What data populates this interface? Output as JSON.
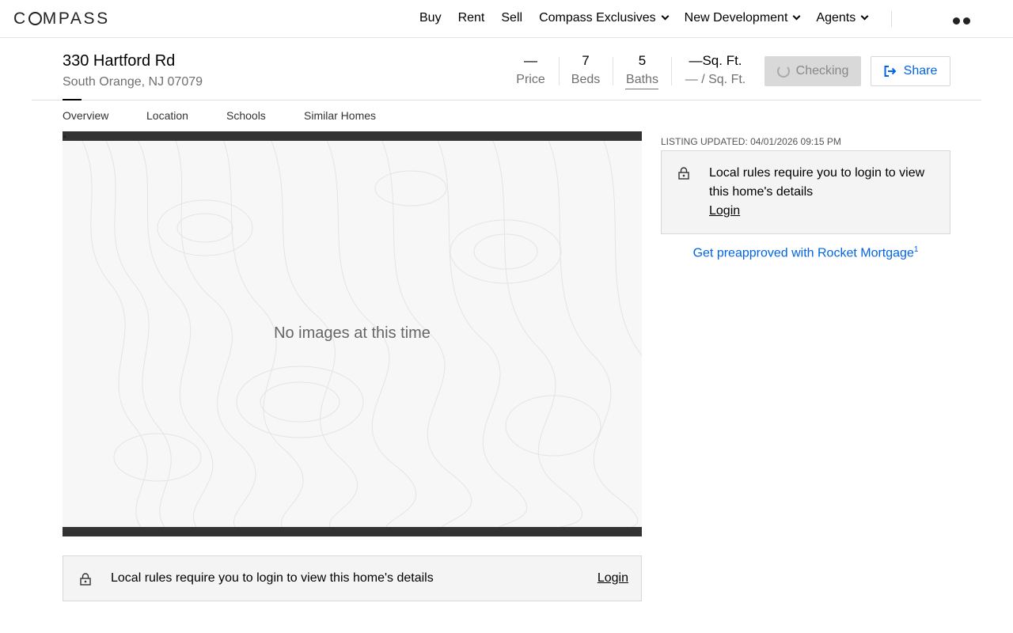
{
  "nav": {
    "logo": "COMPASS",
    "items": [
      {
        "label": "Buy",
        "dropdown": false
      },
      {
        "label": "Rent",
        "dropdown": false
      },
      {
        "label": "Sell",
        "dropdown": false
      },
      {
        "label": "Compass Exclusives",
        "dropdown": true
      },
      {
        "label": "New Development",
        "dropdown": true
      },
      {
        "label": "Agents",
        "dropdown": true
      }
    ]
  },
  "listing": {
    "address": "330 Hartford Rd",
    "locality": "South Orange, NJ 07079",
    "stats": {
      "price_value": "—",
      "price_label": "Price",
      "beds_value": "7",
      "beds_label": "Beds",
      "baths_value": "5",
      "baths_label": "Baths",
      "sqft_value": "—Sq. Ft.",
      "sqft_label": "— / Sq. Ft."
    },
    "checking_label": "Checking",
    "share_label": "Share"
  },
  "tabs": [
    "Overview",
    "Location",
    "Schools",
    "Similar Homes"
  ],
  "gallery": {
    "empty_text": "No images at this time"
  },
  "banner": {
    "text": "Local rules require you to login to view this home's details",
    "login": "Login"
  },
  "sidebar": {
    "listing_updated": "LISTING UPDATED: 04/01/2026 09:15 PM",
    "card_text": "Local rules require you to login to view this home's details",
    "card_login": "Login",
    "rocket_link": "Get preapproved with Rocket Mortgage",
    "rocket_sup": "1"
  },
  "colors": {
    "link_blue": "#0064e5",
    "muted_text": "#6f6f6f",
    "panel_bg": "#f4f4f4"
  },
  "icons": [
    "chevron-down-icon",
    "spinner-icon",
    "share-icon",
    "lock-icon",
    "broken-image-icon"
  ]
}
